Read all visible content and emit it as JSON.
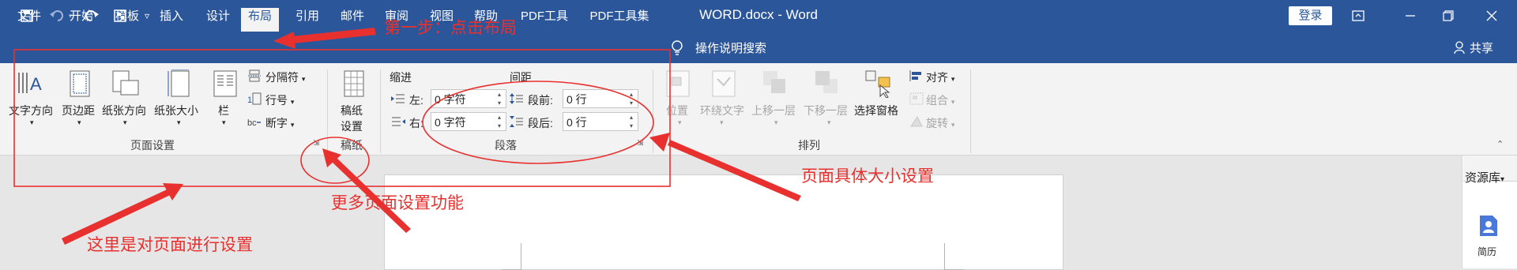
{
  "titlebar": {
    "doc_title": "WORD.docx - Word",
    "login_label": "登录",
    "quick_access": [
      "save-icon",
      "undo-icon",
      "redo-icon",
      "touch-mode-icon",
      "customize-icon"
    ],
    "window_controls": [
      "ribbon-display-icon",
      "minimize-icon",
      "restore-icon",
      "close-icon"
    ]
  },
  "tabs": [
    "文件",
    "开始",
    "模板",
    "插入",
    "设计",
    "布局",
    "引用",
    "邮件",
    "审阅",
    "视图",
    "帮助",
    "PDF工具",
    "PDF工具集"
  ],
  "active_tab": "布局",
  "tellme": "操作说明搜索",
  "share": "共享",
  "ribbon": {
    "page_setup": {
      "label": "页面设置",
      "text_direction": "文字方向",
      "margins": "页边距",
      "orientation": "纸张方向",
      "size": "纸张大小",
      "columns": "栏",
      "breaks": "分隔符",
      "line_numbers": "行号",
      "hyphenation": "断字"
    },
    "manuscript": {
      "label": "稿纸",
      "settings_line1": "稿纸",
      "settings_line2": "设置"
    },
    "paragraph": {
      "label": "段落",
      "indent_title": "缩进",
      "spacing_title": "间距",
      "left_label": "左:",
      "right_label": "右:",
      "before_label": "段前:",
      "after_label": "段后:",
      "left_value": "0 字符",
      "right_value": "0 字符",
      "before_value": "0 行",
      "after_value": "0 行"
    },
    "arrange": {
      "label": "排列",
      "position": "位置",
      "wrap_text": "环绕文字",
      "bring_forward": "上移一层",
      "send_backward": "下移一层",
      "selection_pane": "选择窗格",
      "align": "对齐",
      "group": "组合",
      "rotate": "旋转"
    }
  },
  "right_pane": {
    "resource_label": "资源库",
    "resume_label": "简历"
  },
  "annotations": {
    "step1": "第一步：点击布局",
    "page_size": "页面具体大小设置",
    "more_setup": "更多页面设置功能",
    "here_setup": "这里是对页面进行设置"
  },
  "colors": {
    "title_bar": "#2b579a",
    "ribbon_bg": "#f3f3f3",
    "annotation_red": "#e8312f"
  }
}
